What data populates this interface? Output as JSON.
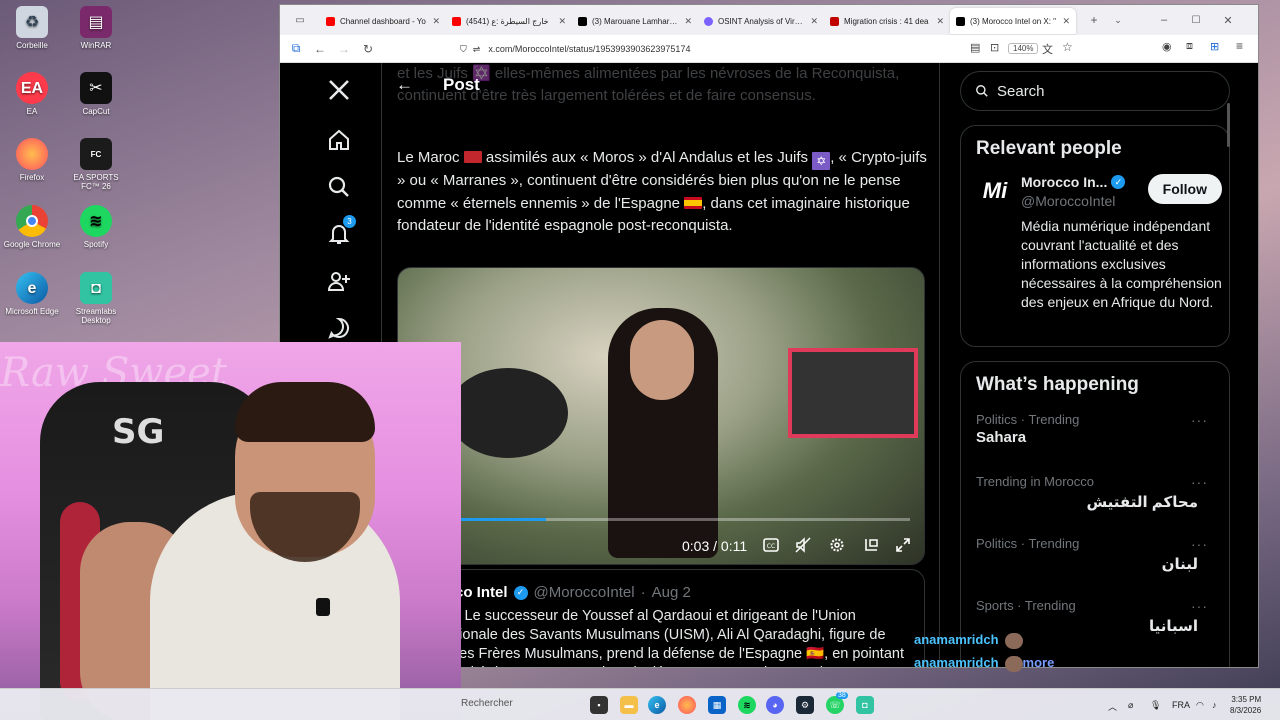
{
  "desktop": {
    "icons": [
      {
        "label": "Corbeille"
      },
      {
        "label": "WinRAR"
      },
      {
        "label": "EA"
      },
      {
        "label": "CapCut"
      },
      {
        "label": "Firefox"
      },
      {
        "label": "EA SPORTS FC™ 26"
      },
      {
        "label": "Google Chrome"
      },
      {
        "label": "Spotify"
      },
      {
        "label": "Microsoft Edge"
      },
      {
        "label": "Streamlabs Desktop"
      }
    ]
  },
  "browser": {
    "tabs": [
      {
        "title": "Channel dashboard - Yo",
        "color": "#ff0000"
      },
      {
        "title": "خارج السيطرة :ع (4541)",
        "color": "#ff0000"
      },
      {
        "title": "(3) Marouane Lamharzi /",
        "color": "#000000"
      },
      {
        "title": "OSINT Analysis of Viral N",
        "color": "#7b61ff"
      },
      {
        "title": "Migration crisis : 41 dea",
        "color": "#c00000"
      },
      {
        "title": "(3) Morocco Intel on X: \"",
        "color": "#000000"
      }
    ],
    "url": "x.com/MoroccoIntel/status/1953993903623975174",
    "zoom": "140%"
  },
  "x": {
    "nav_badge": "3",
    "post_header": "Post",
    "prev_text": "et les Juifs ✡️ elles-mêmes alimentées par les névroses de la Reconquista, continuent d'être très largement tolérées et de faire consensus.",
    "body_parts": {
      "p1": "Le Maroc",
      "p2": " assimilés aux « Moros » d'Al Andalus et les Juifs ",
      "p3": ", « Crypto-juifs » ou « Marranes », continuent d'être considérés bien plus qu'on ne le pense comme « éternels ennemis » de l'Espagne",
      "p4": ", dans cet imaginaire historique fondateur de l'identité espagnole post-reconquista."
    },
    "video": {
      "time": "0:03 / 0:11",
      "progress": 0.27
    },
    "quote": {
      "name": "Morocco Intel",
      "handle": "@MoroccoIntel",
      "date": "Aug 2",
      "text": "FLASH| Le successeur de Youssef al Qardaoui et dirigeant de l'Union Internationale des Savants Musulmans (UISM), Ali Al Qaradaghi, figure de proue des Frères Musulmans, prend la défense de l'Espagne 🇪🇸, en pointant à l'hispanité de \"Ceuta\", sans jamais dénoncer une seule x.com/..."
    },
    "sidebar": {
      "search_placeholder": "Search",
      "relevant_title": "Relevant people",
      "person": {
        "name": "Morocco In...",
        "handle": "@MoroccoIntel",
        "follow": "Follow",
        "bio": "Média numérique indépendant couvrant l'actualité et des informations exclusives nécessaires à la compréhension des enjeux en Afrique du Nord."
      },
      "happening_title": "What’s happening",
      "trends": [
        {
          "meta": "Politics · Trending",
          "title": "Sahara"
        },
        {
          "meta": "Trending in Morocco",
          "title": "محاكم التفتيش"
        },
        {
          "meta": "Politics · Trending",
          "title": "لبنان"
        },
        {
          "meta": "Sports · Trending",
          "title": "اسبانيا"
        }
      ]
    }
  },
  "overlay": {
    "watermark": "Raw Sweet",
    "chat": [
      {
        "user": "anamamridch",
        "text": ""
      },
      {
        "user": "anamamridch",
        "text": "more"
      }
    ]
  },
  "taskbar": {
    "search": "Rechercher",
    "lang": "FRA",
    "time": "3:35 PM",
    "date": "8/3/2026",
    "teams_badge": "38"
  }
}
